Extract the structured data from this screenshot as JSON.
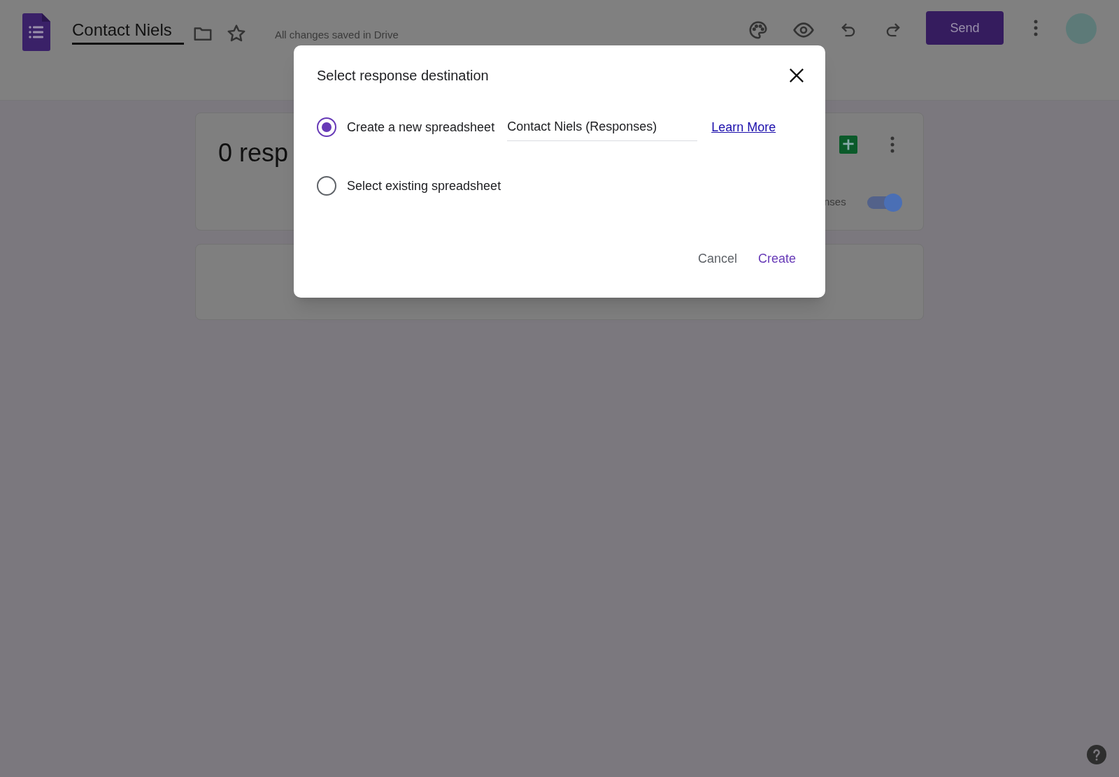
{
  "header": {
    "title": "Contact Niels",
    "save_status": "All changes saved in Drive",
    "send_button": "Send"
  },
  "summary_card": {
    "count_text": "0 resp",
    "accepting_label": "nses",
    "accepting": {
      "on": true
    }
  },
  "dialog": {
    "title": "Select response destination",
    "options": [
      {
        "label": "Create a new spreadsheet",
        "selected": true,
        "kind": "new",
        "field_value": "Contact Niels (Responses)",
        "link": "Learn More"
      },
      {
        "label": "Select existing spreadsheet",
        "selected": false,
        "kind": "existing"
      }
    ],
    "buttons": [
      {
        "label": "Cancel",
        "kind": "secondary"
      },
      {
        "label": "Create",
        "kind": "primary"
      }
    ]
  }
}
